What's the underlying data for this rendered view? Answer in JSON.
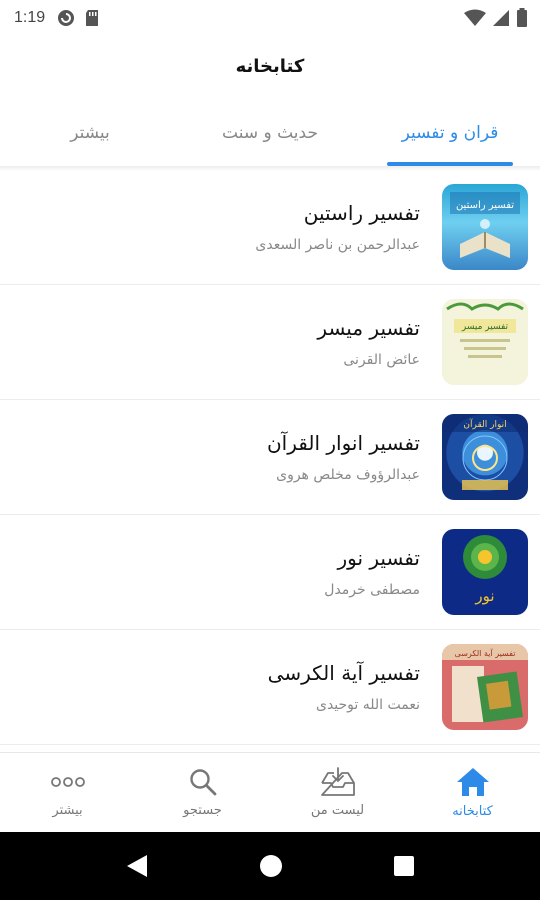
{
  "status_bar": {
    "time": "1:19"
  },
  "app": {
    "title": "کتابخانه"
  },
  "tabs": [
    {
      "label": "قران و تفسیر",
      "active": true
    },
    {
      "label": "حدیث و سنت",
      "active": false
    },
    {
      "label": "بیشتر",
      "active": false
    }
  ],
  "books": [
    {
      "title": "تفسیر راستین",
      "author": "عبدالرحمن بن ناصر السعدی",
      "cover_text": "تفسیر راستین"
    },
    {
      "title": "تفسیر میسر",
      "author": "عائض القرنی",
      "cover_text": "تفسیر میسر"
    },
    {
      "title": "تفسیر انوار القرآن",
      "author": "عبدالرؤوف مخلص هروی",
      "cover_text": "انوار القرآن"
    },
    {
      "title": "تفسیر نور",
      "author": "مصطفی خرمدل",
      "cover_text": "تفسیر نور"
    },
    {
      "title": "تفسیر آیة الکرسی",
      "author": "نعمت الله توحیدی",
      "cover_text": "تفسیر آیة الكرسی"
    }
  ],
  "bottom_nav": [
    {
      "label": "کتابخانه",
      "icon": "home-icon",
      "active": true
    },
    {
      "label": "لیست من",
      "icon": "download-tray-icon",
      "active": false
    },
    {
      "label": "جستجو",
      "icon": "search-icon",
      "active": false
    },
    {
      "label": "بیشتر",
      "icon": "more-dots-icon",
      "active": false
    }
  ],
  "colors": {
    "accent": "#2d8ae8",
    "text_primary": "#111111",
    "text_secondary": "#888888"
  }
}
